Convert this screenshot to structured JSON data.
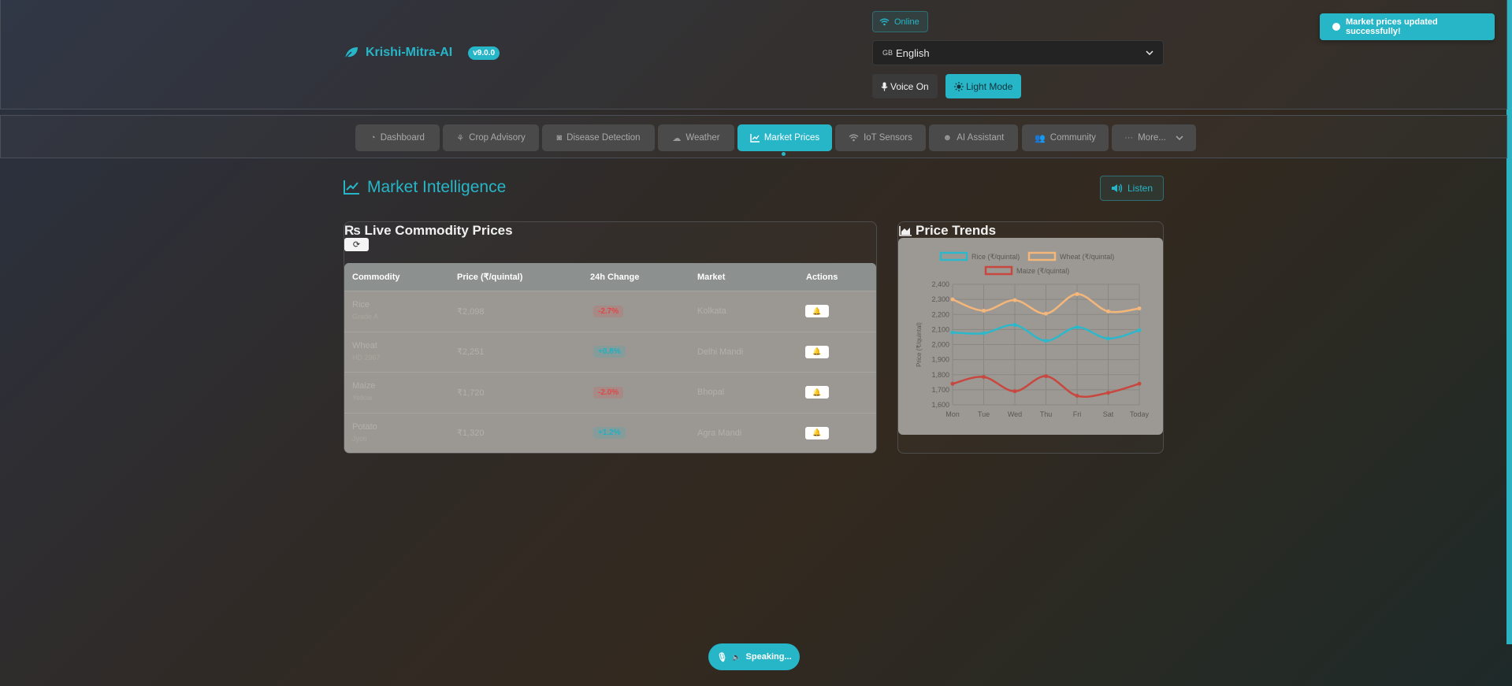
{
  "header": {
    "app_name": "Krishi-Mitra-AI",
    "version": "v9.0.0",
    "status": "Online",
    "language": {
      "flag": "GB",
      "selected": "English"
    },
    "voice_label": "Voice On",
    "theme_label": "Light Mode"
  },
  "toast": {
    "message": "Market prices updated successfully!"
  },
  "nav": {
    "tabs": [
      {
        "label": "Dashboard",
        "icon": "gauge-icon"
      },
      {
        "label": "Crop Advisory",
        "icon": "seedling-icon"
      },
      {
        "label": "Disease Detection",
        "icon": "camera-icon"
      },
      {
        "label": "Weather",
        "icon": "cloud-sun-icon"
      },
      {
        "label": "Market Prices",
        "icon": "chart-line-icon",
        "active": true
      },
      {
        "label": "IoT Sensors",
        "icon": "wifi-icon"
      },
      {
        "label": "AI Assistant",
        "icon": "robot-icon"
      },
      {
        "label": "Community",
        "icon": "users-icon"
      },
      {
        "label": "More...",
        "icon": "ellipsis-icon"
      }
    ]
  },
  "page": {
    "title": "Market Intelligence",
    "listen_label": "Listen"
  },
  "prices_card": {
    "title": "₨ Live Commodity Prices",
    "columns": [
      "Commodity",
      "Price (₹/quintal)",
      "24h Change",
      "Market",
      "Actions"
    ],
    "rows": [
      {
        "commodity": "Rice",
        "sub": "Grade A",
        "price": "₹2,098",
        "change": "-2.7%",
        "dir": "down",
        "market": "Kolkata"
      },
      {
        "commodity": "Wheat",
        "sub": "HD 2967",
        "price": "₹2,251",
        "change": "+0.8%",
        "dir": "up",
        "market": "Delhi Mandi"
      },
      {
        "commodity": "Maize",
        "sub": "Yellow",
        "price": "₹1,720",
        "change": "-2.0%",
        "dir": "down",
        "market": "Bhopal"
      },
      {
        "commodity": "Potato",
        "sub": "Jyoti",
        "price": "₹1,320",
        "change": "+1.2%",
        "dir": "up",
        "market": "Agra Mandi"
      }
    ]
  },
  "trends_card": {
    "title": "Price Trends"
  },
  "chart_data": {
    "type": "line",
    "categories": [
      "Mon",
      "Tue",
      "Wed",
      "Thu",
      "Fri",
      "Sat",
      "Today"
    ],
    "series": [
      {
        "name": "Rice (₹/quintal)",
        "color": "#2bb8cb",
        "values": [
          2080,
          2075,
          2130,
          2025,
          2115,
          2040,
          2095
        ]
      },
      {
        "name": "Wheat (₹/quintal)",
        "color": "#f5b67a",
        "values": [
          2300,
          2225,
          2295,
          2205,
          2335,
          2220,
          2240
        ]
      },
      {
        "name": "Maize (₹/quintal)",
        "color": "#c8473e",
        "values": [
          1740,
          1785,
          1690,
          1790,
          1660,
          1680,
          1740
        ]
      }
    ],
    "ylabel": "Price (₹/quintal)",
    "ylim": [
      1600,
      2400
    ],
    "yticks": [
      "1,600",
      "1,700",
      "1,800",
      "1,900",
      "2,000",
      "2,100",
      "2,200",
      "2,300",
      "2,400"
    ],
    "grid": true,
    "legend": "top"
  },
  "speaking": {
    "label": "Speaking..."
  }
}
